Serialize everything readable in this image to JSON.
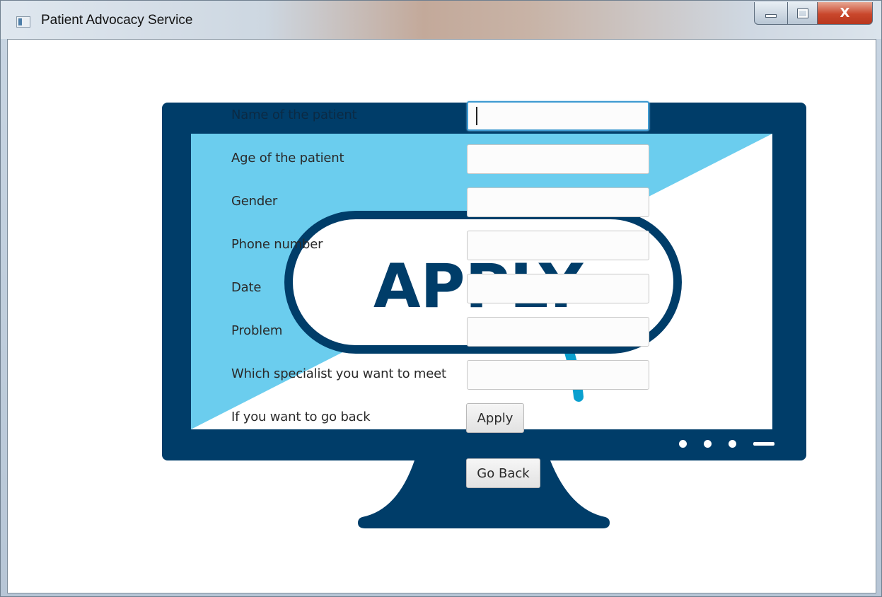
{
  "window": {
    "title": "Patient Advocacy Service",
    "close_glyph": "X"
  },
  "graphic": {
    "apply_text": "APPLY"
  },
  "form": {
    "fields": [
      {
        "label": "Name of the patient",
        "value": ""
      },
      {
        "label": "Age of the patient",
        "value": ""
      },
      {
        "label": "Gender",
        "value": ""
      },
      {
        "label": "Phone number",
        "value": ""
      },
      {
        "label": "Date",
        "value": ""
      },
      {
        "label": "Problem",
        "value": ""
      },
      {
        "label": "Which specialist you want to meet",
        "value": ""
      }
    ],
    "back_prompt": "If you want to go back",
    "apply_label": "Apply",
    "go_back_label": "Go Back"
  },
  "colors": {
    "monitor": "#003d69",
    "screen_accent": "#6bcdee",
    "focus_ring": "#3e9ad1"
  },
  "icons": {
    "app": "app-window-icon",
    "minimize": "minimize-icon",
    "maximize": "maximize-icon",
    "close": "close-icon"
  }
}
